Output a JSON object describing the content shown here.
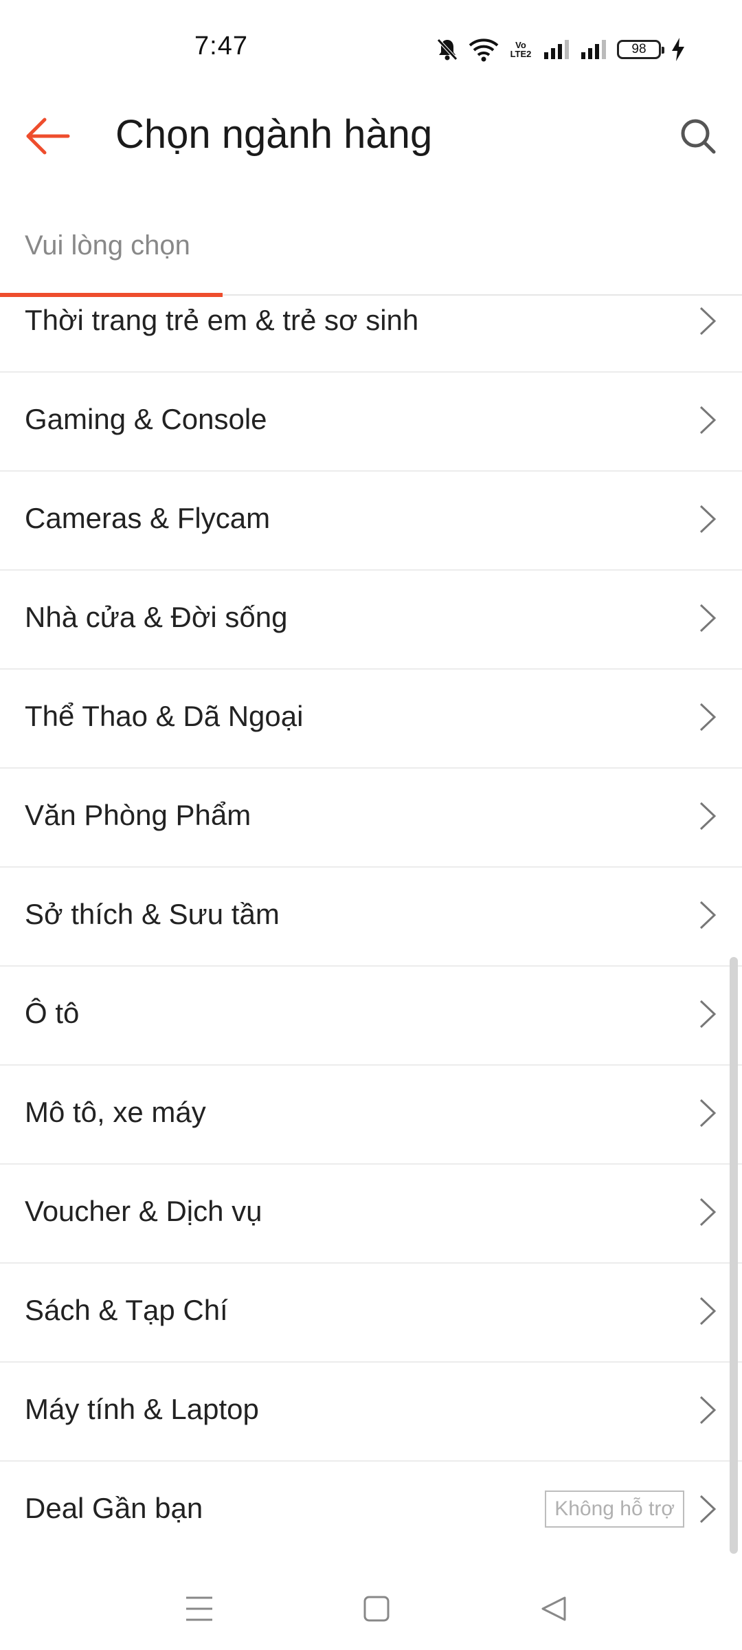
{
  "status_bar": {
    "time": "7:47",
    "network_label_top": "Vo",
    "network_label_bottom": "LTE2",
    "battery": "98",
    "icons": [
      "bell-off-icon",
      "wifi-icon",
      "volte-icon",
      "signal-icon",
      "signal-icon",
      "battery-icon",
      "charging-icon"
    ]
  },
  "app_bar": {
    "title": "Chọn ngành hàng",
    "back_icon": "arrow-left-icon",
    "search_icon": "search-icon",
    "accent_color": "#ee4d2d"
  },
  "tabs": [
    {
      "label": "Vui lòng chọn",
      "active": true
    }
  ],
  "categories": [
    {
      "label": "Thời trang trẻ em & trẻ sơ sinh"
    },
    {
      "label": "Gaming & Console"
    },
    {
      "label": "Cameras & Flycam"
    },
    {
      "label": "Nhà cửa & Đời sống"
    },
    {
      "label": "Thể Thao & Dã Ngoại"
    },
    {
      "label": "Văn Phòng Phẩm"
    },
    {
      "label": "Sở thích & Sưu tầm"
    },
    {
      "label": "Ô tô"
    },
    {
      "label": "Mô tô, xe máy"
    },
    {
      "label": "Voucher & Dịch vụ"
    },
    {
      "label": "Sách & Tạp Chí"
    },
    {
      "label": "Máy tính & Laptop"
    },
    {
      "label": "Deal Gần bạn",
      "badge": "Không hỗ trợ"
    }
  ],
  "nav_bar": {
    "icons": [
      "menu-icon",
      "home-square-icon",
      "back-triangle-icon"
    ]
  }
}
